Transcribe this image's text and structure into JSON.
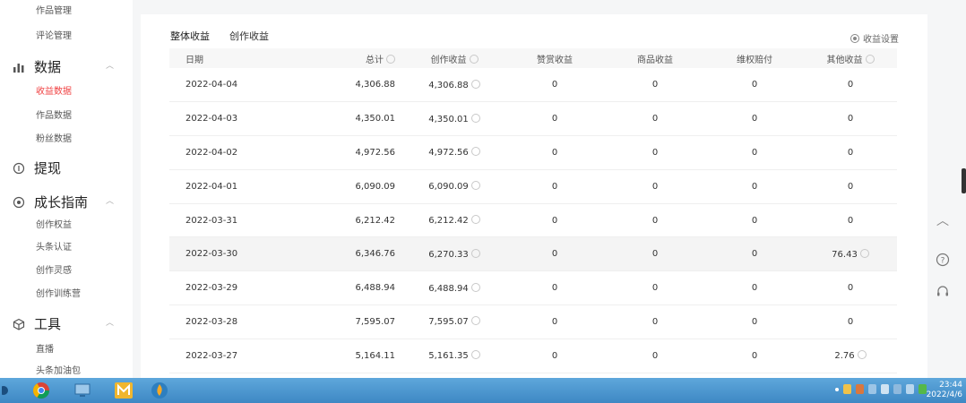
{
  "sidebar": {
    "top_items": [
      "作品管理",
      "评论管理"
    ],
    "groups": {
      "data": {
        "label": "数据",
        "items": [
          "收益数据",
          "作品数据",
          "粉丝数据"
        ]
      },
      "withdraw": {
        "label": "提现"
      },
      "growth": {
        "label": "成长指南",
        "items": [
          "创作权益",
          "头条认证",
          "创作灵感",
          "创作训练营"
        ]
      },
      "tools": {
        "label": "工具",
        "items": [
          "直播",
          "头条加油包"
        ]
      }
    },
    "active_item": "收益数据"
  },
  "tabs": [
    {
      "label": "整体收益",
      "active": true
    },
    {
      "label": "创作收益",
      "active": false
    }
  ],
  "settings_label": "收益设置",
  "table": {
    "columns": [
      "日期",
      "总计",
      "创作收益",
      "赞赏收益",
      "商品收益",
      "维权赔付",
      "其他收益"
    ],
    "rows": [
      [
        "2022-04-04",
        "4,306.88",
        "4,306.88",
        "0",
        "0",
        "0",
        "0"
      ],
      [
        "2022-04-03",
        "4,350.01",
        "4,350.01",
        "0",
        "0",
        "0",
        "0"
      ],
      [
        "2022-04-02",
        "4,972.56",
        "4,972.56",
        "0",
        "0",
        "0",
        "0"
      ],
      [
        "2022-04-01",
        "6,090.09",
        "6,090.09",
        "0",
        "0",
        "0",
        "0"
      ],
      [
        "2022-03-31",
        "6,212.42",
        "6,212.42",
        "0",
        "0",
        "0",
        "0"
      ],
      [
        "2022-03-30",
        "6,346.76",
        "6,270.33",
        "0",
        "0",
        "0",
        "76.43"
      ],
      [
        "2022-03-29",
        "6,488.94",
        "6,488.94",
        "0",
        "0",
        "0",
        "0"
      ],
      [
        "2022-03-28",
        "7,595.07",
        "7,595.07",
        "0",
        "0",
        "0",
        "0"
      ],
      [
        "2022-03-27",
        "5,164.11",
        "5,161.35",
        "0",
        "0",
        "0",
        "2.76"
      ]
    ]
  },
  "taskbar": {
    "time": "23:44",
    "date": "2022/4/6"
  },
  "colors": {
    "accent": "#f04142",
    "taskbar": "#4a94cf"
  }
}
